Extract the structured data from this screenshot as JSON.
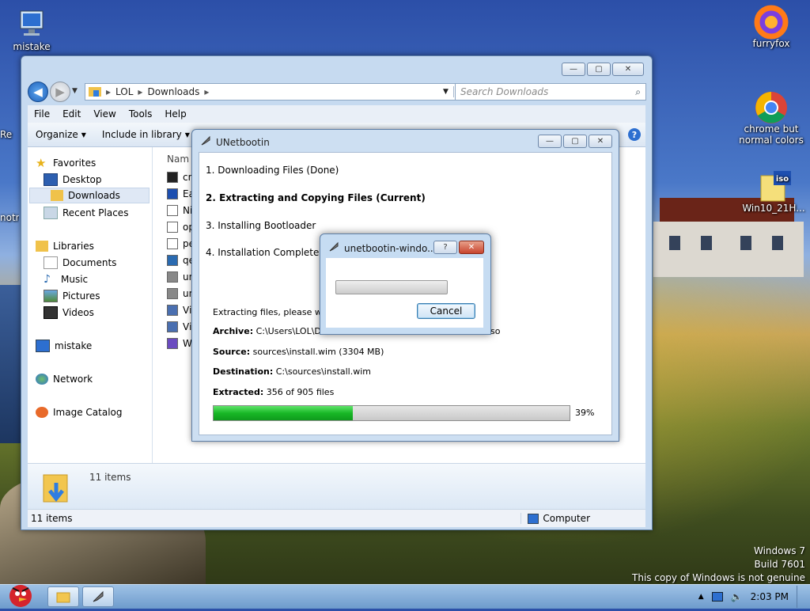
{
  "desktop": {
    "icons": [
      {
        "label": "mistake"
      },
      {
        "label": "furryfox"
      },
      {
        "label": "chrome but normal colors"
      },
      {
        "label": "Win10_21H..."
      },
      {
        "label": "Re"
      },
      {
        "label": "notr"
      }
    ],
    "watermark": {
      "line1": "Windows 7",
      "line2": "Build 7601",
      "line3": "This copy of Windows is not genuine"
    }
  },
  "explorer": {
    "breadcrumb": [
      "LOL",
      "Downloads"
    ],
    "search_placeholder": "Search Downloads",
    "menu": [
      "File",
      "Edit",
      "View",
      "Tools",
      "Help"
    ],
    "commands": {
      "organize": "Organize",
      "include": "Include in library"
    },
    "column_name": "Nam",
    "nav": {
      "favorites": "Favorites",
      "desktop": "Desktop",
      "downloads": "Downloads",
      "recent": "Recent Places",
      "libraries": "Libraries",
      "documents": "Documents",
      "music": "Music",
      "pictures": "Pictures",
      "videos": "Videos",
      "mistake": "mistake",
      "network": "Network",
      "image_catalog": "Image Catalog"
    },
    "files": [
      {
        "name": "cn",
        "icon": "cmd-icon"
      },
      {
        "name": "Ea",
        "icon": "iso-icon"
      },
      {
        "name": "Ni",
        "icon": "text-icon"
      },
      {
        "name": "op",
        "icon": "file-icon"
      },
      {
        "name": "pe",
        "icon": "file-icon"
      },
      {
        "name": "qe",
        "icon": "q-icon"
      },
      {
        "name": "un",
        "icon": "unetbootin-icon"
      },
      {
        "name": "un",
        "icon": "unetbootin-icon"
      },
      {
        "name": "Vi",
        "icon": "vbox-icon"
      },
      {
        "name": "Vi",
        "icon": "vbox-icon"
      },
      {
        "name": "W",
        "icon": "shield-icon"
      }
    ],
    "details_count": "11 items",
    "status_count": "11 items",
    "status_location": "Computer"
  },
  "unetbootin": {
    "title": "UNetbootin",
    "steps": {
      "s1": "1. Downloading Files (Done)",
      "s2": "2. Extracting and Copying Files (Current)",
      "s3": "3. Installing Bootloader",
      "s4": "4. Installation Complete"
    },
    "status": "Extracting files, please wait...",
    "archive_label": "Archive:",
    "archive_value": "C:\\Users\\LOL\\Dest",
    "archive_tail": "so",
    "source_label": "Source:",
    "source_value": "sources\\install.wim (3304 MB)",
    "destination_label": "Destination:",
    "destination_value": "C:\\sources\\install.wim",
    "extracted_label": "Extracted:",
    "extracted_value": "356 of 905 files",
    "progress": 0.39,
    "progress_text": "39%"
  },
  "dialog": {
    "title": "unetbootin-windo...",
    "help": "?",
    "cancel": "Cancel",
    "progress": 0.0
  },
  "taskbar": {
    "time": "2:03 PM"
  }
}
